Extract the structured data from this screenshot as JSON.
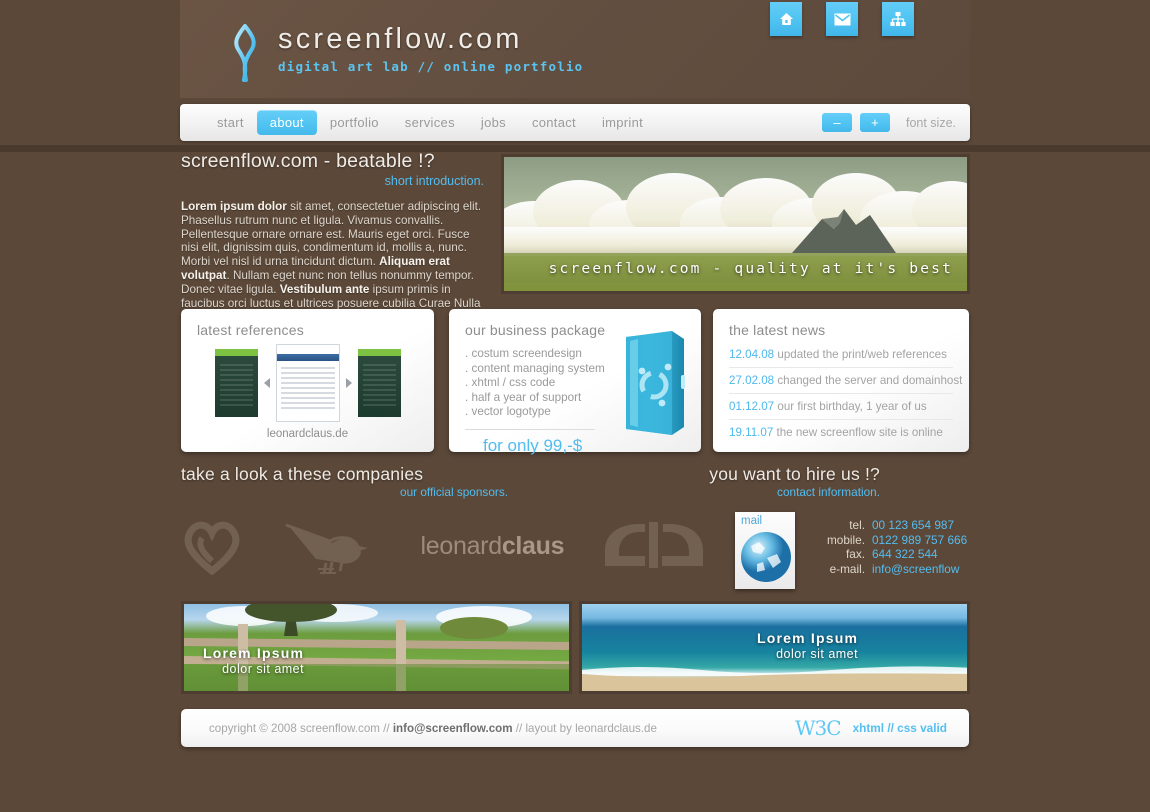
{
  "site": {
    "logo_title": "screenflow.com",
    "logo_subtitle": "digital art lab // online portfolio",
    "logo_icon": "ribbon-icon"
  },
  "header_icons": [
    {
      "name": "home-icon",
      "label": "home"
    },
    {
      "name": "mail-icon",
      "label": "mail"
    },
    {
      "name": "sitemap-icon",
      "label": "sitemap"
    }
  ],
  "nav": {
    "items": [
      {
        "label": "start",
        "active": false
      },
      {
        "label": "about",
        "active": true
      },
      {
        "label": "portfolio",
        "active": false
      },
      {
        "label": "services",
        "active": false
      },
      {
        "label": "jobs",
        "active": false
      },
      {
        "label": "contact",
        "active": false
      },
      {
        "label": "imprint",
        "active": false
      }
    ],
    "font_decrease": "–",
    "font_increase": "+",
    "font_size_label": "font size."
  },
  "intro": {
    "title": "screenflow.com - beatable !?",
    "subtitle": "short introduction.",
    "paragraph_1_bold": "Lorem ipsum dolor",
    "paragraph_1": " sit amet, consectetuer adipiscing elit. Phasellus rutrum nunc et ligula. Vivamus convallis. Pellentesque ornare ornare est. Mauris eget orci. Fusce nisi elit, dignissim quis, condimentum id, mollis a, nunc. Morbi vel nisl id urna tincidunt dictum. ",
    "paragraph_2_bold": "Aliquam erat volutpat",
    "paragraph_2": ". Nullam eget nunc non tellus nonummy tempor. Donec vitae ligula. ",
    "paragraph_3_bold": "Vestibulum ante",
    "paragraph_3": " ipsum primis in faucibus orci luctus et ultrices posuere cubilia Curae Nulla arcu lorem faucibus."
  },
  "hero": {
    "caption": "screenflow.com - quality at it's best",
    "alt": "clouds over mountain and green field"
  },
  "references": {
    "title": "latest references",
    "caption": "leonardclaus.de",
    "prev": "prev",
    "next": "next"
  },
  "package": {
    "title": "our business package",
    "items": [
      ". costum screendesign",
      ". content managing system",
      ". xhtml / css code",
      ". half a year of support",
      ". vector logotype"
    ],
    "price": "for only 99,-$"
  },
  "news": {
    "title": "the latest news",
    "items": [
      {
        "date": "12.04.08",
        "text": "updated the print/web references"
      },
      {
        "date": "27.02.08",
        "text": "changed the server and domainhost"
      },
      {
        "date": "01.12.07",
        "text": "our first birthday, 1 year of us"
      },
      {
        "date": "19.11.07",
        "text": "the new screenflow site is online"
      }
    ]
  },
  "sponsors_section": {
    "title": "take a look a these companies",
    "subtitle": "our official sponsors.",
    "logos": [
      {
        "name": "heart-logo",
        "label": ""
      },
      {
        "name": "bird-logo",
        "label": ""
      },
      {
        "name": "leonardclaus-logo",
        "label_light": "leonard",
        "label_bold": "claus"
      },
      {
        "name": "deviantart-logo",
        "label": ""
      }
    ]
  },
  "contact_section": {
    "title": "you want to hire us !?",
    "subtitle": "contact information.",
    "mail_card_label": "mail",
    "rows": [
      {
        "key": "tel.",
        "value": "00 123 654 987"
      },
      {
        "key": "mobile.",
        "value": "0122 989 757 666"
      },
      {
        "key": "fax.",
        "value": "644 322 544"
      },
      {
        "key": "e-mail.",
        "value": "info@screenflow"
      }
    ]
  },
  "photos": [
    {
      "name": "fence-field-photo",
      "title": "Lorem Ipsum",
      "subtitle": "dolor sit amet"
    },
    {
      "name": "beach-ocean-photo",
      "title": "Lorem Ipsum",
      "subtitle": "dolor sit amet"
    }
  ],
  "footer": {
    "copyright": "copyright © 2008 screenflow.com  //  ",
    "email": "info@screenflow.com",
    "layout_by": "  //  layout by leonardclaus.de",
    "w3c": "W3C",
    "validity": "xhtml // css valid"
  },
  "colors": {
    "background": "#5b4839",
    "accent_blue": "#51bdef",
    "panel_white": "#ffffff",
    "text_light": "#efeae4",
    "text_grey": "#9b9b9b"
  }
}
